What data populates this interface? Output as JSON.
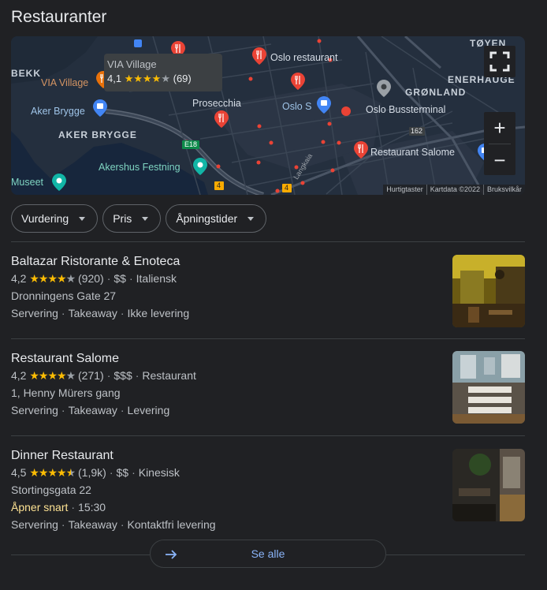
{
  "title": "Restauranter",
  "map": {
    "labels": {
      "bekk": "BEKK",
      "via_village": "VIA Village",
      "oslo_restaurant": "Oslo restaurant",
      "toyen": "TØYEN",
      "enerhaugen": "ENERHAUGE",
      "aker_brygge_blue": "Aker Brygge",
      "prosecchia": "Prosecchia",
      "oslo_s": "Oslo S",
      "oslo_bussterminal": "Oslo Bussterminal",
      "gronland": "GRØNLAND",
      "aker_brygge": "AKER BRYGGE",
      "restaurant_salome": "Restaurant Salome",
      "akershus_festning": "Akershus Festning",
      "museet": "Museet",
      "e18": "E18",
      "r162": "162",
      "r4a": "4",
      "r4b": "4",
      "langkaia": "Langkaia"
    },
    "tooltip": {
      "name": "VIA Village",
      "rating": "4,1",
      "stars": "★★★★",
      "star_empty": "★",
      "count": "(69)"
    },
    "attribution": [
      "Hurtigtaster",
      "Kartdata ©2022",
      "Bruksvilkår"
    ],
    "zoom_in": "+",
    "zoom_out": "−"
  },
  "filters": [
    {
      "label": "Vurdering"
    },
    {
      "label": "Pris"
    },
    {
      "label": "Åpningstider"
    }
  ],
  "results": [
    {
      "name": "Baltazar Ristorante & Enoteca",
      "rating": "4,2",
      "stars": "★★★★",
      "star_empty": "★",
      "reviews": "(920)",
      "price": "$$",
      "category": "Italiensk",
      "address": "Dronningens Gate 27",
      "services": [
        "Servering",
        "Takeaway",
        "Ikke levering"
      ]
    },
    {
      "name": "Restaurant Salome",
      "rating": "4,2",
      "stars": "★★★★",
      "star_empty": "★",
      "reviews": "(271)",
      "price": "$$$",
      "category": "Restaurant",
      "address": "1, Henny Mürers gang",
      "services": [
        "Servering",
        "Takeaway",
        "Levering"
      ]
    },
    {
      "name": "Dinner Restaurant",
      "rating": "4,5",
      "stars": "★★★★",
      "star_half": "★",
      "reviews": "(1,9k)",
      "price": "$$",
      "category": "Kinesisk",
      "address": "Stortingsgata 22",
      "status": "Åpner snart",
      "hours": "15:30",
      "services": [
        "Servering",
        "Takeaway",
        "Kontaktfri levering"
      ]
    }
  ],
  "see_all": "Se alle",
  "colors": {
    "background": "#202124",
    "map_bg": "#242f3e",
    "accent_blue": "#8ab4f8",
    "star": "#fbbc04",
    "pin_red": "#ea4335",
    "open_soon": "#fde293"
  },
  "icons": [
    "fullscreen-icon",
    "restaurant-pin-icon",
    "transit-pin-icon",
    "attraction-pin-icon",
    "arrow-right-icon",
    "caret-down-icon"
  ]
}
